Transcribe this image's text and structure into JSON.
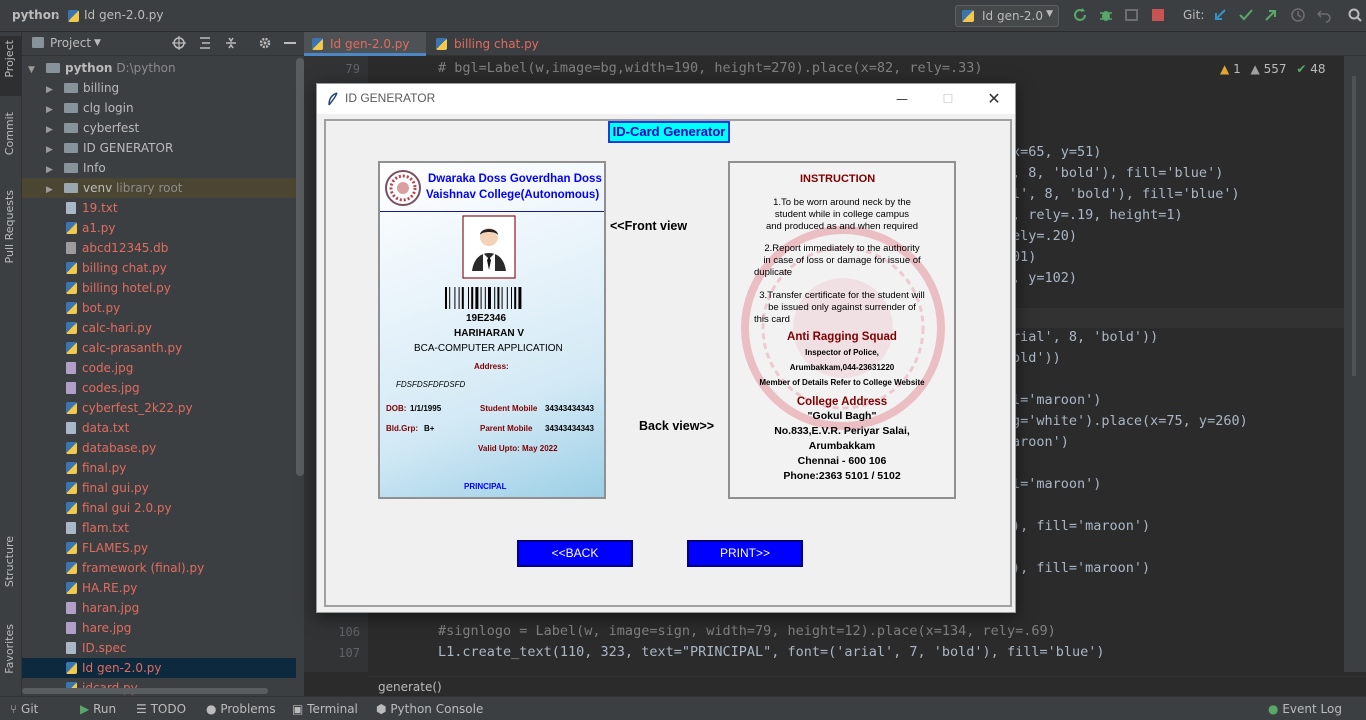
{
  "navbar": {
    "project": "python",
    "file": "Id gen-2.0.py",
    "run_config": "Id gen-2.0",
    "git_label": "Git:"
  },
  "left_strip": {
    "project": "Project",
    "commit": "Commit",
    "pull_requests": "Pull Requests",
    "structure": "Structure",
    "favorites": "Favorites"
  },
  "project_panel": {
    "title": "Project",
    "root_name": "python",
    "root_path": "D:\\python",
    "folders": [
      "billing",
      "clg login",
      "cyberfest",
      "ID GENERATOR",
      "Info"
    ],
    "venv": {
      "name": "venv",
      "hint": "library root"
    },
    "files": [
      "19.txt",
      "a1.py",
      "abcd12345.db",
      "billing chat.py",
      "billing hotel.py",
      "bot.py",
      "calc-hari.py",
      "calc-prasanth.py",
      "code.jpg",
      "codes.jpg",
      "cyberfest_2k22.py",
      "data.txt",
      "database.py",
      "final.py",
      "final gui.py",
      "final gui 2.0.py",
      "flam.txt",
      "FLAMES.py",
      "framework (final).py",
      "HA.RE.py",
      "haran.jpg",
      "hare.jpg",
      "ID.spec",
      "Id gen-2.0.py",
      "idcard.py"
    ]
  },
  "editor": {
    "tabs": [
      "Id gen-2.0.py",
      "billing chat.py"
    ],
    "inspections": {
      "warnings": "1",
      "weak_warnings": "557",
      "ok": "48"
    },
    "lines": [
      {
        "n": "79",
        "text": "# bgl=Label(w,image=bg,width=190, height=270).place(x=82, rely=.33)"
      },
      {
        "n": "",
        "text": "x=65, y=51)"
      },
      {
        "n": "",
        "text": ", 8, 'bold'), fill='blue')"
      },
      {
        "n": "",
        "text": "l', 8, 'bold'), fill='blue')"
      },
      {
        "n": "",
        "text": ", rely=.19, height=1)"
      },
      {
        "n": "",
        "text": "ely=.20)"
      },
      {
        "n": "",
        "text": "01)"
      },
      {
        "n": "",
        "text": ", y=102)"
      },
      {
        "n": "",
        "text": "rial', 8, 'bold'))"
      },
      {
        "n": "",
        "text": "old'))"
      },
      {
        "n": "",
        "text": "l='maroon')"
      },
      {
        "n": "",
        "text": "g='white').place(x=75, y=260)"
      },
      {
        "n": "",
        "text": "aroon')"
      },
      {
        "n": "",
        "text": "l='maroon')"
      },
      {
        "n": "",
        "text": "), fill='maroon')"
      },
      {
        "n": "",
        "text": "), fill='maroon')"
      },
      {
        "n": "106",
        "text": "#signlogo = Label(w, image=sign, width=79, height=12).place(x=134, rely=.69)"
      },
      {
        "n": "107",
        "text": "L1.create_text(110, 323, text=\"PRINCIPAL\", font=('arial', 7, 'bold'), fill='blue')"
      }
    ],
    "status_fn": "generate()"
  },
  "bottom_bar": [
    "Git",
    "Run",
    "TODO",
    "Problems",
    "Terminal",
    "Python Console",
    "Event Log"
  ],
  "dialog": {
    "title": "ID GENERATOR",
    "heading": "ID-Card Generator",
    "front_view": "<<Front view",
    "back_view": "Back view>>",
    "back_button": "<<BACK",
    "print_button": "PRINT>>",
    "front": {
      "college_line1": "Dwaraka Doss Goverdhan Doss",
      "college_line2": "Vaishnav College(Autonomous)",
      "reg_no": "19E2346",
      "name": "HARIHARAN V",
      "course": "BCA-COMPUTER APPLICATION",
      "address_label": "Address:",
      "address": "FDSFDSFDFDSFD",
      "dob_label": "DOB:",
      "dob": "1/1/1995",
      "blood_label": "Bld.Grp:",
      "blood": "B+",
      "student_mobile_label": "Student Mobile",
      "student_mobile": "34343434343",
      "parent_mobile_label": "Parent Mobile",
      "parent_mobile": "34343434343",
      "valid": "Valid Upto: May 2022",
      "principal": "PRINCIPAL"
    },
    "back": {
      "instruction": "INSTRUCTION",
      "rule1": [
        "1.To be worn around  neck by the",
        "student while in college campus",
        "and produced as and when required"
      ],
      "rule2": [
        "2.Report immediately to the authority",
        "in case of loss or damage for issue of",
        "duplicate"
      ],
      "rule3": [
        "3.Transfer certificate for the student will",
        "be issued only against surrender of",
        "this card"
      ],
      "squad": "Anti Ragging Squad",
      "inspector": "Inspector of Police,",
      "inspector_contact": "Arumbakkam,044-23631220",
      "members": "Member of Details Refer to College Website",
      "address_heading": "College Address",
      "address1": "\"Gokul Bagh\"",
      "address2": "No.833,E.V.R. Periyar Salai,",
      "address3": "Arumbakkam",
      "address4": "Chennai - 600 106",
      "phone": "Phone:2363 5101 / 5102"
    }
  },
  "colors": {
    "maroon": "#800000",
    "blue": "#0000ff",
    "cyan": "#00ffff",
    "ide_bg": "#2b2b2b"
  }
}
